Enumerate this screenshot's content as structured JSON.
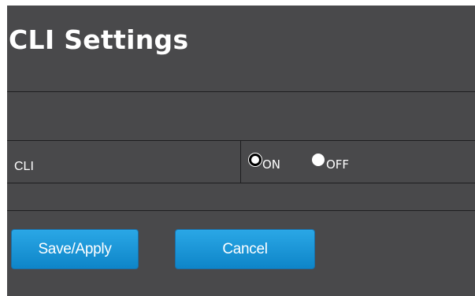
{
  "page_title": "CLI Settings",
  "cli": {
    "label": "CLI",
    "options": [
      {
        "label": "ON",
        "selected": true
      },
      {
        "label": "OFF",
        "selected": false
      }
    ]
  },
  "buttons": {
    "save_label": "Save/Apply",
    "cancel_label": "Cancel"
  },
  "colors": {
    "panel_background": "#49494b",
    "button_blue": "#1a9ad9",
    "text": "#ffffff"
  }
}
